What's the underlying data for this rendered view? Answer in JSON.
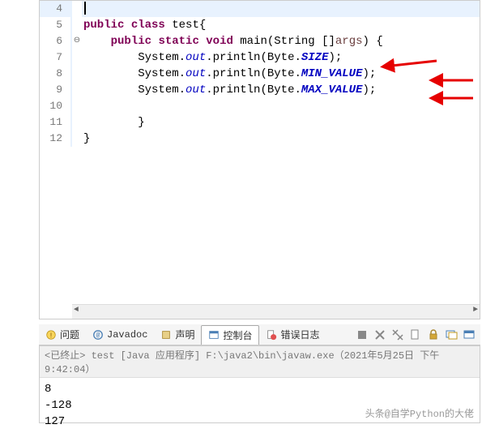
{
  "editor": {
    "lines": [
      {
        "num": "4",
        "current": true,
        "fold": ""
      },
      {
        "num": "5",
        "fold": ""
      },
      {
        "num": "6",
        "fold": "⊖"
      },
      {
        "num": "7",
        "fold": ""
      },
      {
        "num": "8",
        "fold": ""
      },
      {
        "num": "9",
        "fold": ""
      },
      {
        "num": "10",
        "fold": ""
      },
      {
        "num": "11",
        "fold": ""
      },
      {
        "num": "12",
        "fold": ""
      }
    ],
    "code": {
      "l5": {
        "kw1": "public",
        "kw2": "class",
        "name": " test{"
      },
      "l6": {
        "kw1": "public",
        "kw2": "static",
        "kw3": "void",
        "mname": " main(String []",
        "param": "args",
        "close": ") {"
      },
      "l7": {
        "pre": "        System.",
        "out": "out",
        "mid": ".println(Byte.",
        "const": "SIZE",
        "post": ");"
      },
      "l8": {
        "pre": "        System.",
        "out": "out",
        "mid": ".println(Byte.",
        "const": "MIN_VALUE",
        "post": ");"
      },
      "l9": {
        "pre": "        System.",
        "out": "out",
        "mid": ".println(Byte.",
        "const": "MAX_VALUE",
        "post": ");"
      },
      "l10": "",
      "l11": "        }",
      "l12": "}"
    }
  },
  "tabs": {
    "problems": "问题",
    "javadoc": "Javadoc",
    "declaration": "声明",
    "console": "控制台",
    "errorlog": "错误日志"
  },
  "console": {
    "header": "<已终止> test [Java 应用程序] F:\\java2\\bin\\javaw.exe（2021年5月25日 下午9:42:04）",
    "out1": "8",
    "out2": "-128",
    "out3": "127"
  },
  "watermark": "头条@自学Python的大佬",
  "chart_data": null
}
